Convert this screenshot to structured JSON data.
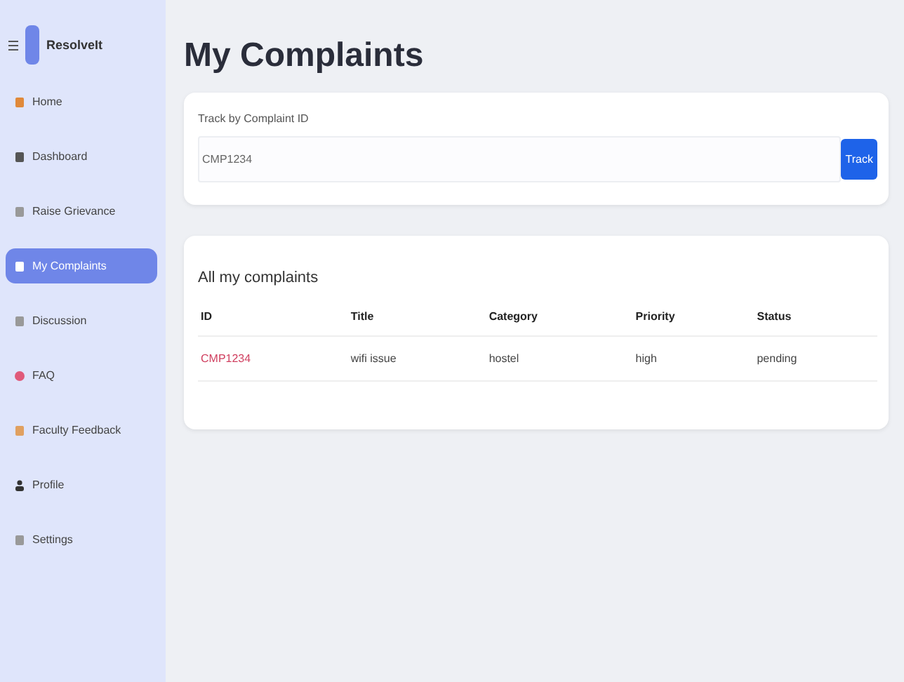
{
  "sidebar": {
    "brand": "ResolveIt",
    "items": [
      {
        "label": "Home",
        "selected": false
      },
      {
        "label": "Dashboard",
        "selected": false
      },
      {
        "label": "Raise Grievance",
        "selected": false
      },
      {
        "label": "My Complaints",
        "selected": true
      },
      {
        "label": "Discussion",
        "selected": false
      },
      {
        "label": "FAQ",
        "selected": false
      },
      {
        "label": "Faculty Feedback",
        "selected": false
      },
      {
        "label": "Profile",
        "selected": false
      },
      {
        "label": "Settings",
        "selected": false
      }
    ]
  },
  "page_title": "My Complaints",
  "track": {
    "label": "Track by Complaint ID",
    "value": "CMP1234",
    "button": "Track"
  },
  "complaints": {
    "title": "All my complaints",
    "columns": [
      "ID",
      "Title",
      "Category",
      "Priority",
      "Status"
    ],
    "rows": [
      [
        "CMP1234",
        "wifi issue",
        "hostel",
        "high",
        "pending"
      ]
    ]
  }
}
